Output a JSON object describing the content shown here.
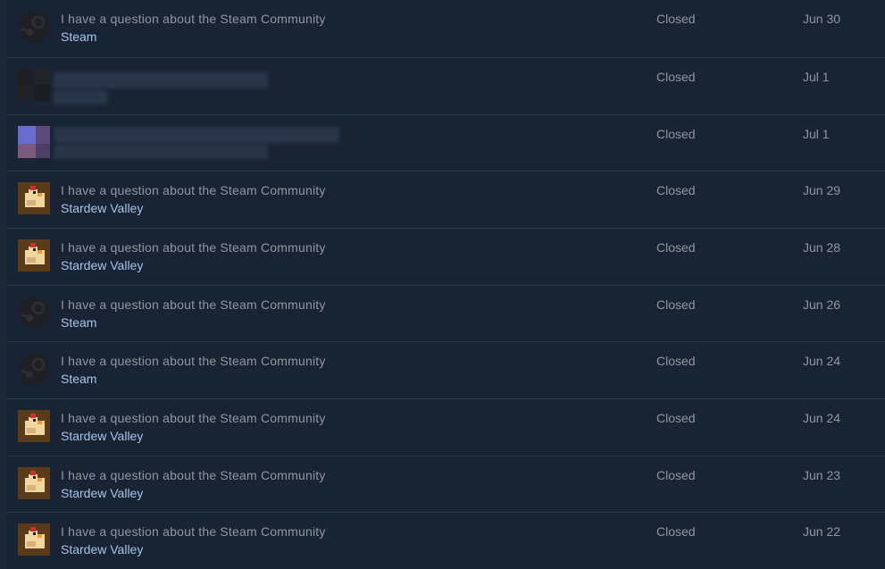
{
  "tickets": [
    {
      "title": "I have a question about the Steam Community",
      "product": "Steam",
      "status": "Closed",
      "date": "Jun 30",
      "icon": "steam-logo-icon"
    },
    {
      "title": "",
      "product": "",
      "status": "Closed",
      "date": "Jul 1",
      "icon": "redacted-avatar-icon"
    },
    {
      "title": "",
      "product": "",
      "status": "Closed",
      "date": "Jul 1",
      "icon": "redacted-avatar-icon"
    },
    {
      "title": "I have a question about the Steam Community",
      "product": "Stardew Valley",
      "status": "Closed",
      "date": "Jun 29",
      "icon": "stardew-chicken-icon"
    },
    {
      "title": "I have a question about the Steam Community",
      "product": "Stardew Valley",
      "status": "Closed",
      "date": "Jun 28",
      "icon": "stardew-chicken-icon"
    },
    {
      "title": "I have a question about the Steam Community",
      "product": "Steam",
      "status": "Closed",
      "date": "Jun 26",
      "icon": "steam-logo-icon"
    },
    {
      "title": "I have a question about the Steam Community",
      "product": "Steam",
      "status": "Closed",
      "date": "Jun 24",
      "icon": "steam-logo-icon"
    },
    {
      "title": "I have a question about the Steam Community",
      "product": "Stardew Valley",
      "status": "Closed",
      "date": "Jun 24",
      "icon": "stardew-chicken-icon"
    },
    {
      "title": "I have a question about the Steam Community",
      "product": "Stardew Valley",
      "status": "Closed",
      "date": "Jun 23",
      "icon": "stardew-chicken-icon"
    },
    {
      "title": "I have a question about the Steam Community",
      "product": "Stardew Valley",
      "status": "Closed",
      "date": "Jun 22",
      "icon": "stardew-chicken-icon"
    }
  ],
  "colors": {
    "background": "#1b2838",
    "panel": "#182334",
    "divider": "#2a3a4e",
    "text_muted": "#8f98a0",
    "link": "#a7c5e6"
  }
}
